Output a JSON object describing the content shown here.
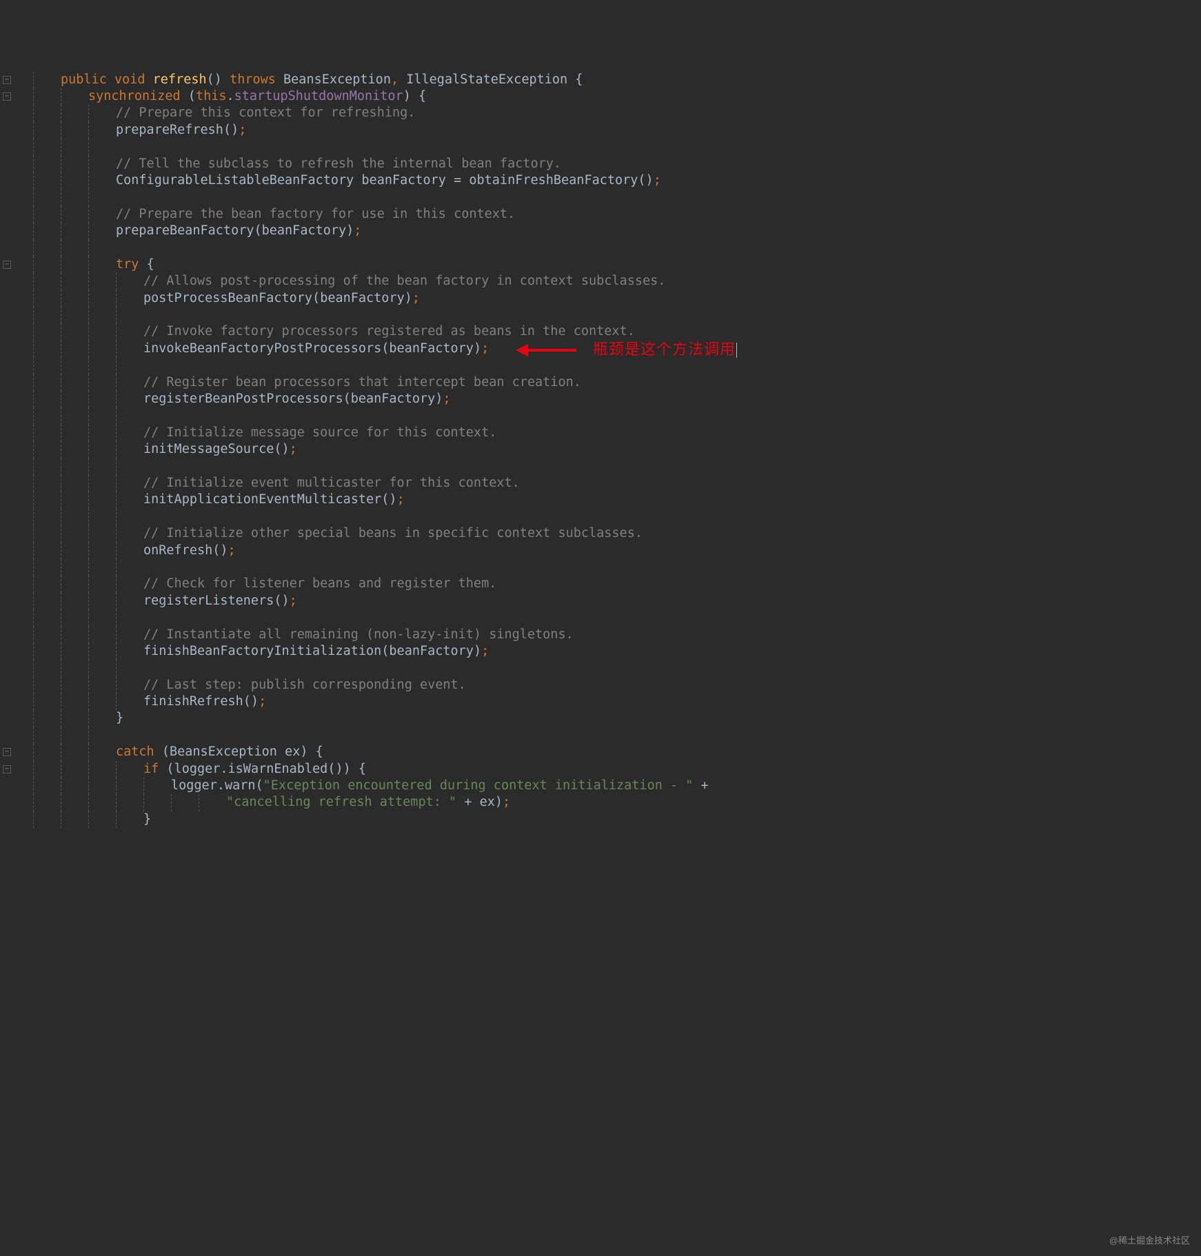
{
  "watermark": "@稀土掘金技术社区",
  "annotation": {
    "text": "瓶颈是这个方法调用",
    "targetLineIndex": 17
  },
  "indentGuidePositions": [
    0,
    40,
    80,
    120,
    160,
    200,
    240
  ],
  "lines": [
    {
      "indent": 1,
      "fold": true,
      "tokens": [
        {
          "t": "public",
          "c": "kw"
        },
        {
          "t": " "
        },
        {
          "t": "void",
          "c": "kw"
        },
        {
          "t": " "
        },
        {
          "t": "refresh",
          "c": "mname"
        },
        {
          "t": "()",
          "c": "brc"
        },
        {
          "t": " "
        },
        {
          "t": "throws",
          "c": "kw"
        },
        {
          "t": " "
        },
        {
          "t": "BeansException",
          "c": "type"
        },
        {
          "t": ",",
          "c": "pun"
        },
        {
          "t": " "
        },
        {
          "t": "IllegalStateException",
          "c": "type"
        },
        {
          "t": " "
        },
        {
          "t": "{",
          "c": "brc"
        }
      ]
    },
    {
      "indent": 2,
      "fold": true,
      "tokens": [
        {
          "t": "synchronized",
          "c": "kw"
        },
        {
          "t": " "
        },
        {
          "t": "(",
          "c": "brc"
        },
        {
          "t": "this",
          "c": "kw"
        },
        {
          "t": "."
        },
        {
          "t": "startupShutdownMonitor",
          "c": "fld"
        },
        {
          "t": ")",
          "c": "brc"
        },
        {
          "t": " "
        },
        {
          "t": "{",
          "c": "brc"
        }
      ]
    },
    {
      "indent": 3,
      "tokens": [
        {
          "t": "// Prepare this context for refreshing.",
          "c": "cmt"
        }
      ]
    },
    {
      "indent": 3,
      "tokens": [
        {
          "t": "prepareRefresh",
          "c": "id"
        },
        {
          "t": "()",
          "c": "brc"
        },
        {
          "t": ";",
          "c": "pun"
        }
      ]
    },
    {
      "indent": 3,
      "blank": true
    },
    {
      "indent": 3,
      "tokens": [
        {
          "t": "// Tell the subclass to refresh the internal bean factory.",
          "c": "cmt"
        }
      ]
    },
    {
      "indent": 3,
      "tokens": [
        {
          "t": "ConfigurableListableBeanFactory",
          "c": "type"
        },
        {
          "t": " "
        },
        {
          "t": "beanFactory",
          "c": "id"
        },
        {
          "t": " = "
        },
        {
          "t": "obtainFreshBeanFactory",
          "c": "id"
        },
        {
          "t": "()",
          "c": "brc"
        },
        {
          "t": ";",
          "c": "pun"
        }
      ]
    },
    {
      "indent": 3,
      "blank": true
    },
    {
      "indent": 3,
      "tokens": [
        {
          "t": "// Prepare the bean factory for use in this context.",
          "c": "cmt"
        }
      ]
    },
    {
      "indent": 3,
      "tokens": [
        {
          "t": "prepareBeanFactory",
          "c": "id"
        },
        {
          "t": "(",
          "c": "brc"
        },
        {
          "t": "beanFactory",
          "c": "id"
        },
        {
          "t": ")",
          "c": "brc"
        },
        {
          "t": ";",
          "c": "pun"
        }
      ]
    },
    {
      "indent": 3,
      "blank": true
    },
    {
      "indent": 3,
      "fold": true,
      "tokens": [
        {
          "t": "try",
          "c": "kw"
        },
        {
          "t": " "
        },
        {
          "t": "{",
          "c": "brc"
        }
      ]
    },
    {
      "indent": 4,
      "tokens": [
        {
          "t": "// Allows post-processing of the bean factory in context subclasses.",
          "c": "cmt"
        }
      ]
    },
    {
      "indent": 4,
      "tokens": [
        {
          "t": "postProcessBeanFactory",
          "c": "id"
        },
        {
          "t": "(",
          "c": "brc"
        },
        {
          "t": "beanFactory",
          "c": "id"
        },
        {
          "t": ")",
          "c": "brc"
        },
        {
          "t": ";",
          "c": "pun"
        }
      ]
    },
    {
      "indent": 4,
      "blank": true
    },
    {
      "indent": 4,
      "tokens": [
        {
          "t": "// Invoke factory processors registered as beans in the context.",
          "c": "cmt"
        }
      ]
    },
    {
      "indent": 4,
      "tokens": [
        {
          "t": "invokeBeanFactoryPostProcessors",
          "c": "id"
        },
        {
          "t": "(",
          "c": "brc"
        },
        {
          "t": "beanFactory",
          "c": "id"
        },
        {
          "t": ")",
          "c": "brc"
        },
        {
          "t": ";",
          "c": "pun"
        }
      ]
    },
    {
      "indent": 4,
      "blank": true
    },
    {
      "indent": 4,
      "tokens": [
        {
          "t": "// Register bean processors that intercept bean creation.",
          "c": "cmt"
        }
      ]
    },
    {
      "indent": 4,
      "tokens": [
        {
          "t": "registerBeanPostProcessors",
          "c": "id"
        },
        {
          "t": "(",
          "c": "brc"
        },
        {
          "t": "beanFactory",
          "c": "id"
        },
        {
          "t": ")",
          "c": "brc"
        },
        {
          "t": ";",
          "c": "pun"
        }
      ]
    },
    {
      "indent": 4,
      "blank": true
    },
    {
      "indent": 4,
      "tokens": [
        {
          "t": "// Initialize message source for this context.",
          "c": "cmt"
        }
      ]
    },
    {
      "indent": 4,
      "tokens": [
        {
          "t": "initMessageSource",
          "c": "id"
        },
        {
          "t": "()",
          "c": "brc"
        },
        {
          "t": ";",
          "c": "pun"
        }
      ]
    },
    {
      "indent": 4,
      "blank": true
    },
    {
      "indent": 4,
      "tokens": [
        {
          "t": "// Initialize event multicaster for this context.",
          "c": "cmt"
        }
      ]
    },
    {
      "indent": 4,
      "tokens": [
        {
          "t": "initApplicationEventMulticaster",
          "c": "id"
        },
        {
          "t": "()",
          "c": "brc"
        },
        {
          "t": ";",
          "c": "pun"
        }
      ]
    },
    {
      "indent": 4,
      "blank": true
    },
    {
      "indent": 4,
      "tokens": [
        {
          "t": "// Initialize other special beans in specific context subclasses.",
          "c": "cmt"
        }
      ]
    },
    {
      "indent": 4,
      "tokens": [
        {
          "t": "onRefresh",
          "c": "id"
        },
        {
          "t": "()",
          "c": "brc"
        },
        {
          "t": ";",
          "c": "pun"
        }
      ]
    },
    {
      "indent": 4,
      "blank": true
    },
    {
      "indent": 4,
      "tokens": [
        {
          "t": "// Check for listener beans and register them.",
          "c": "cmt"
        }
      ]
    },
    {
      "indent": 4,
      "tokens": [
        {
          "t": "registerListeners",
          "c": "id"
        },
        {
          "t": "()",
          "c": "brc"
        },
        {
          "t": ";",
          "c": "pun"
        }
      ]
    },
    {
      "indent": 4,
      "blank": true
    },
    {
      "indent": 4,
      "tokens": [
        {
          "t": "// Instantiate all remaining (non-lazy-init) singletons.",
          "c": "cmt"
        }
      ]
    },
    {
      "indent": 4,
      "tokens": [
        {
          "t": "finishBeanFactoryInitialization",
          "c": "id"
        },
        {
          "t": "(",
          "c": "brc"
        },
        {
          "t": "beanFactory",
          "c": "id"
        },
        {
          "t": ")",
          "c": "brc"
        },
        {
          "t": ";",
          "c": "pun"
        }
      ]
    },
    {
      "indent": 4,
      "blank": true
    },
    {
      "indent": 4,
      "tokens": [
        {
          "t": "// Last step: publish corresponding event.",
          "c": "cmt"
        }
      ]
    },
    {
      "indent": 4,
      "tokens": [
        {
          "t": "finishRefresh",
          "c": "id"
        },
        {
          "t": "()",
          "c": "brc"
        },
        {
          "t": ";",
          "c": "pun"
        }
      ]
    },
    {
      "indent": 3,
      "tokens": [
        {
          "t": "}",
          "c": "brc"
        }
      ]
    },
    {
      "indent": 3,
      "blank": true
    },
    {
      "indent": 3,
      "fold": true,
      "tokens": [
        {
          "t": "catch",
          "c": "kw"
        },
        {
          "t": " "
        },
        {
          "t": "(",
          "c": "brc"
        },
        {
          "t": "BeansException",
          "c": "type"
        },
        {
          "t": " "
        },
        {
          "t": "ex",
          "c": "id"
        },
        {
          "t": ")",
          "c": "brc"
        },
        {
          "t": " "
        },
        {
          "t": "{",
          "c": "brc"
        }
      ]
    },
    {
      "indent": 4,
      "fold": true,
      "tokens": [
        {
          "t": "if",
          "c": "kw"
        },
        {
          "t": " "
        },
        {
          "t": "(",
          "c": "brc"
        },
        {
          "t": "logger",
          "c": "id"
        },
        {
          "t": "."
        },
        {
          "t": "isWarnEnabled",
          "c": "id"
        },
        {
          "t": "()",
          "c": "brc"
        },
        {
          "t": ")",
          "c": "brc"
        },
        {
          "t": " "
        },
        {
          "t": "{",
          "c": "brc"
        }
      ]
    },
    {
      "indent": 5,
      "tokens": [
        {
          "t": "logger",
          "c": "id"
        },
        {
          "t": "."
        },
        {
          "t": "warn",
          "c": "id"
        },
        {
          "t": "(",
          "c": "brc"
        },
        {
          "t": "\"Exception encountered during context initialization - \"",
          "c": "str"
        },
        {
          "t": " + "
        }
      ]
    },
    {
      "indent": 7,
      "tokens": [
        {
          "t": "\"cancelling refresh attempt: \"",
          "c": "str"
        },
        {
          "t": " + "
        },
        {
          "t": "ex",
          "c": "id"
        },
        {
          "t": ")",
          "c": "brc"
        },
        {
          "t": ";",
          "c": "pun"
        }
      ]
    },
    {
      "indent": 4,
      "tokens": [
        {
          "t": "}",
          "c": "brc"
        }
      ]
    }
  ]
}
